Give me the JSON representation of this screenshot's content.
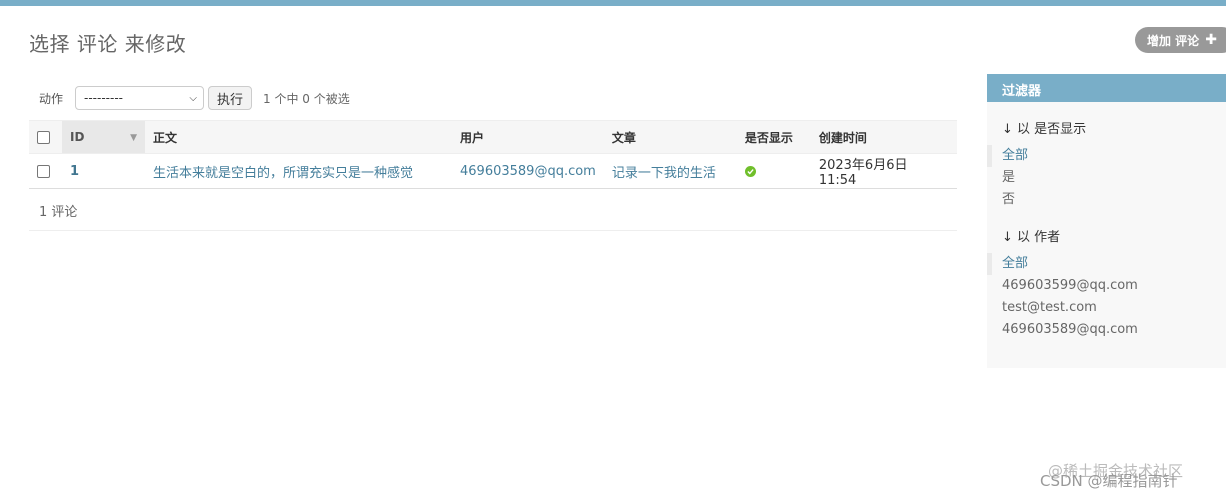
{
  "page": {
    "title": "选择 评论 来修改",
    "add_button_label": "增加 评论",
    "add_button_icon": "plus-icon"
  },
  "actions": {
    "label": "动作",
    "select_value": "---------",
    "go_label": "执行",
    "counter": "1 个中 0 个被选"
  },
  "table": {
    "columns": [
      "ID",
      "正文",
      "用户",
      "文章",
      "是否显示",
      "创建时间"
    ],
    "rows": [
      {
        "id": "1",
        "body": "生活本来就是空白的，所谓充实只是一种感觉",
        "user": "469603589@qq.com",
        "article": "记录一下我的生活",
        "is_displayed": "yes",
        "created": "2023年6月6日 11:54"
      }
    ]
  },
  "paginator": {
    "text": "1 评论"
  },
  "filter": {
    "header": "过滤器",
    "groups": [
      {
        "title": "↓ 以 是否显示",
        "items": [
          "全部",
          "是",
          "否"
        ],
        "selected": 0
      },
      {
        "title": "↓ 以 作者",
        "items": [
          "全部",
          "469603599@qq.com",
          "test@test.com",
          "469603589@qq.com"
        ],
        "selected": 0
      }
    ]
  },
  "watermarks": {
    "line1": "@稀土掘金技术社区",
    "line2": "CSDN @编程指南针"
  },
  "colors": {
    "accent": "#79aec8",
    "link": "#447e9b",
    "check_green": "#70bf2b",
    "add_button_bg": "#999999"
  }
}
